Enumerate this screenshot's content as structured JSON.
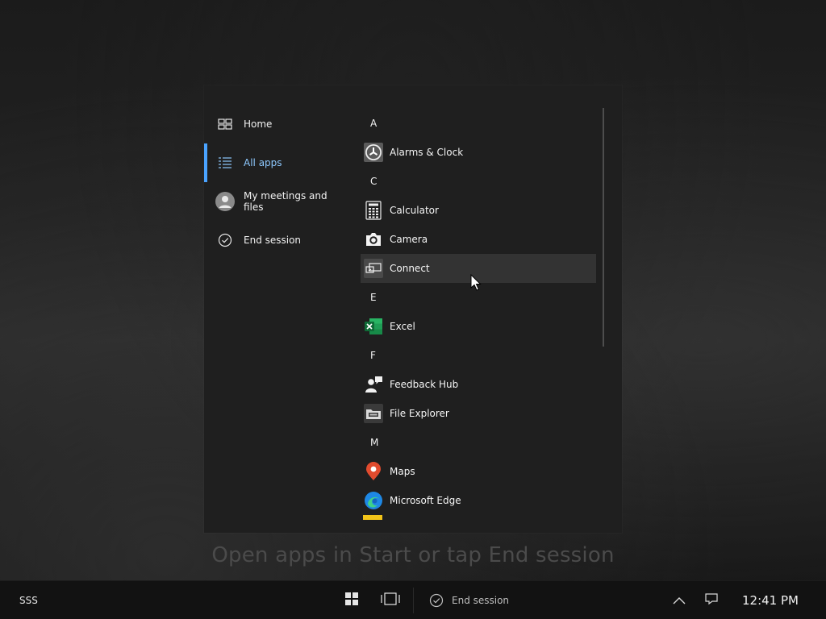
{
  "nav": {
    "items": [
      {
        "label": "Home",
        "icon": "home-icon"
      },
      {
        "label": "All apps",
        "icon": "list-icon",
        "active": true
      },
      {
        "label": "My meetings and files",
        "icon": "avatar-icon"
      },
      {
        "label": "End session",
        "icon": "check-circle-icon"
      }
    ]
  },
  "apps": {
    "groups": [
      {
        "letter": "A",
        "items": [
          {
            "label": "Alarms & Clock",
            "icon": "alarm-clock-icon"
          }
        ]
      },
      {
        "letter": "C",
        "items": [
          {
            "label": "Calculator",
            "icon": "calculator-icon"
          },
          {
            "label": "Camera",
            "icon": "camera-icon"
          },
          {
            "label": "Connect",
            "icon": "connect-icon",
            "hovered": true
          }
        ]
      },
      {
        "letter": "E",
        "items": [
          {
            "label": "Excel",
            "icon": "excel-icon"
          }
        ]
      },
      {
        "letter": "F",
        "items": [
          {
            "label": "Feedback Hub",
            "icon": "feedback-hub-icon"
          },
          {
            "label": "File Explorer",
            "icon": "file-explorer-icon"
          }
        ]
      },
      {
        "letter": "M",
        "items": [
          {
            "label": "Maps",
            "icon": "maps-icon"
          },
          {
            "label": "Microsoft Edge",
            "icon": "edge-icon"
          }
        ]
      }
    ]
  },
  "hint": "Open apps in Start or tap End session",
  "taskbar": {
    "left_label": "SSS",
    "end_session_label": "End session",
    "time": "12:41 PM"
  },
  "colors": {
    "accent": "#4aa3ff",
    "active_text": "#8ec9ff",
    "panel_bg": "#1f1f1f",
    "taskbar_bg": "#121212"
  }
}
